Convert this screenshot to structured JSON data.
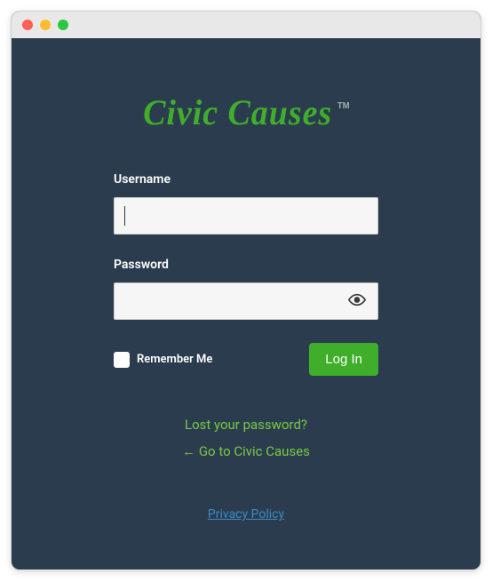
{
  "logo": {
    "text": "Civic Causes",
    "tm": "TM"
  },
  "form": {
    "username_label": "Username",
    "username_value": "",
    "password_label": "Password",
    "password_value": "",
    "remember_label": "Remember Me",
    "login_label": "Log In"
  },
  "links": {
    "lost": "Lost your password?",
    "back": "← Go to Civic Causes",
    "privacy": "Privacy Policy"
  },
  "colors": {
    "accent": "#3fae2a",
    "bg": "#2b3c4e",
    "link_green": "#7ac943",
    "link_blue": "#3a8bc7"
  }
}
